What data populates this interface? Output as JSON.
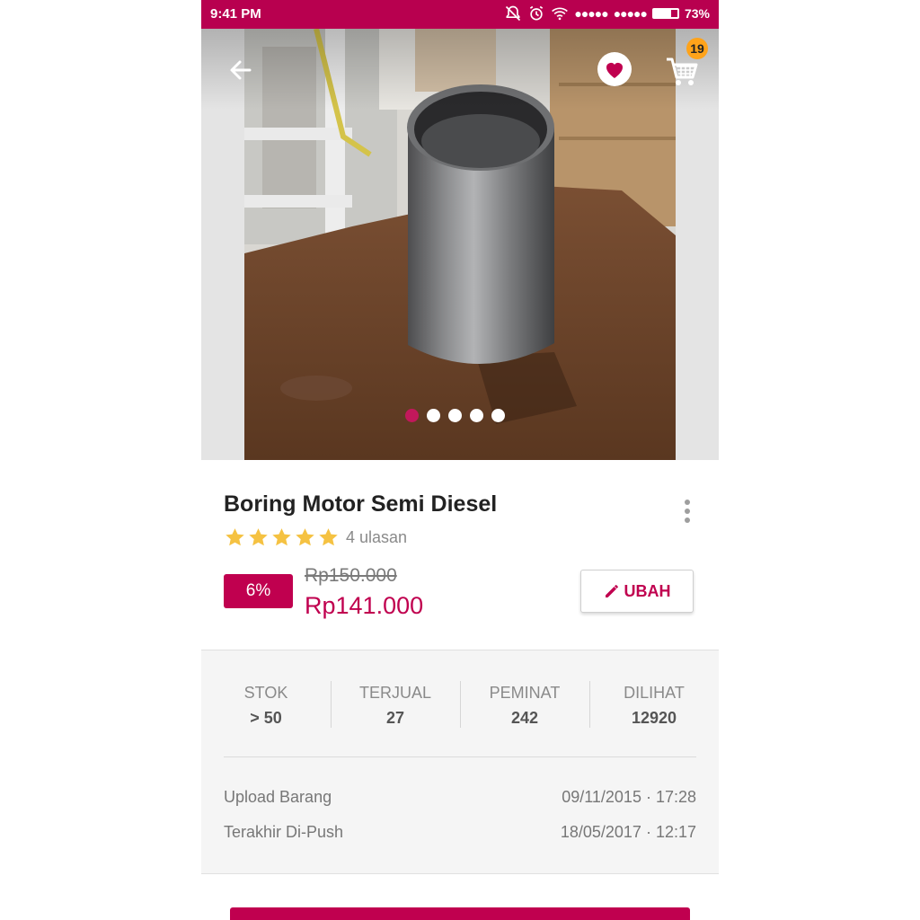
{
  "status_bar": {
    "time": "9:41 PM",
    "battery": "73%",
    "battery_level": 0.73
  },
  "header": {
    "cart_count": "19"
  },
  "gallery": {
    "image_count": 5,
    "active_index": 0
  },
  "product": {
    "title": "Boring Motor Semi Diesel",
    "rating": 5,
    "reviews": "4 ulasan",
    "discount": "6%",
    "original_price": "Rp150.000",
    "price": "Rp141.000",
    "edit_label": "UBAH"
  },
  "stats": [
    {
      "label": "STOK",
      "value": "> 50"
    },
    {
      "label": "TERJUAL",
      "value": "27"
    },
    {
      "label": "PEMINAT",
      "value": "242"
    },
    {
      "label": "DILIHAT",
      "value": "12920"
    }
  ],
  "info": {
    "upload_label": "Upload Barang",
    "upload_value": "09/11/2015 · 17:28",
    "push_label": "Terakhir Di-Push",
    "push_value": "18/05/2017 · 12:17"
  },
  "colors": {
    "brand": "#b8004f",
    "accent": "#c0004f",
    "star": "#f5c242",
    "badge": "#ffa31a"
  }
}
